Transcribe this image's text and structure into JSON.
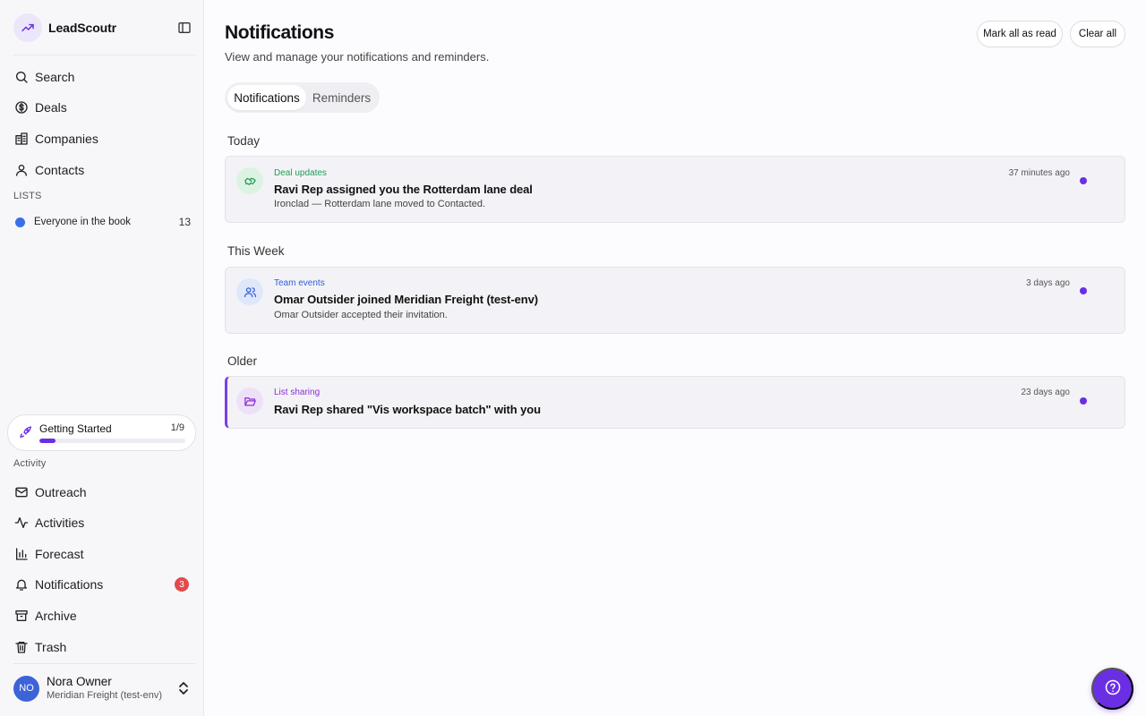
{
  "app": {
    "name": "LeadScoutr"
  },
  "sidebar": {
    "nav_top": [
      {
        "label": "Search",
        "icon": "search-icon"
      },
      {
        "label": "Deals",
        "icon": "dollar-circle-icon"
      },
      {
        "label": "Companies",
        "icon": "building-icon"
      },
      {
        "label": "Contacts",
        "icon": "user-icon"
      }
    ],
    "lists_label": "LISTS",
    "lists": [
      {
        "label": "Everyone in the book",
        "count": "13",
        "color": "#3b6fe6"
      }
    ],
    "getting_started": {
      "label": "Getting Started",
      "count": "1/9",
      "progress": 0.11
    },
    "activity_label": "Activity",
    "nav_activity": [
      {
        "label": "Outreach",
        "icon": "mail-icon"
      },
      {
        "label": "Activities",
        "icon": "activity-icon"
      },
      {
        "label": "Forecast",
        "icon": "bar-chart-icon"
      },
      {
        "label": "Notifications",
        "icon": "bell-icon",
        "badge": "3"
      },
      {
        "label": "Archive",
        "icon": "archive-icon"
      },
      {
        "label": "Trash",
        "icon": "trash-icon"
      }
    ],
    "user": {
      "initials": "NO",
      "name": "Nora Owner",
      "org": "Meridian Freight (test-env)"
    }
  },
  "page": {
    "title": "Notifications",
    "subtitle": "View and manage your notifications and reminders.",
    "mark_all_label": "Mark all as read",
    "clear_all_label": "Clear all",
    "tabs": [
      {
        "label": "Notifications",
        "active": true
      },
      {
        "label": "Reminders",
        "active": false
      }
    ]
  },
  "groups": [
    {
      "label": "Today",
      "items": [
        {
          "category": "Deal updates",
          "category_color": "#1f9d55",
          "icon": "handshake-icon",
          "title": "Ravi Rep assigned you the Rotterdam lane deal",
          "description": "Ironclad — Rotterdam lane moved to Contacted.",
          "time": "37 minutes ago",
          "unread": true
        }
      ]
    },
    {
      "label": "This Week",
      "items": [
        {
          "category": "Team events",
          "category_color": "#2f5fd6",
          "icon": "users-icon",
          "title": "Omar Outsider joined Meridian Freight (test-env)",
          "description": "Omar Outsider accepted their invitation.",
          "time": "3 days ago",
          "unread": true
        }
      ]
    },
    {
      "label": "Older",
      "items": [
        {
          "category": "List sharing",
          "category_color": "#8a2fd6",
          "icon": "folder-open-icon",
          "title": "Ravi Rep shared \"Vis workspace batch\" with you",
          "description": "",
          "time": "23 days ago",
          "unread": true
        }
      ]
    }
  ],
  "colors": {
    "accent": "#6b2fe3",
    "badge": "#e14b4b"
  },
  "help": {
    "icon": "help-circle-icon"
  }
}
